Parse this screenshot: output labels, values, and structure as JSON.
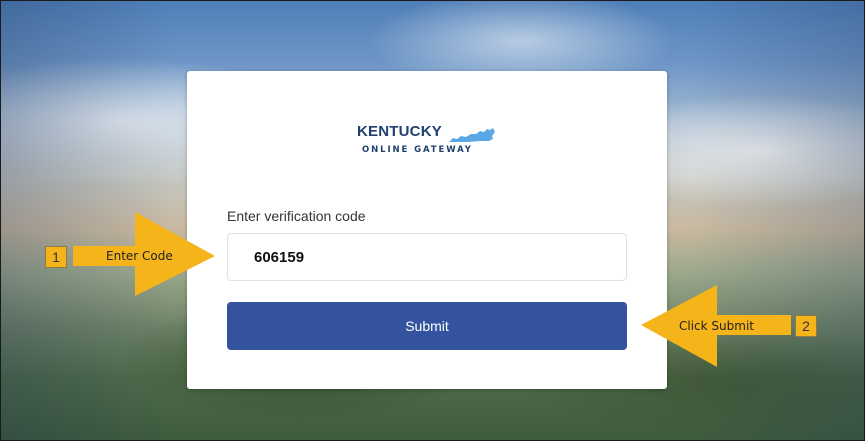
{
  "logo": {
    "word": "KENTUCKY",
    "subtitle": "ONLINE GATEWAY",
    "text_color": "#1f3f6e",
    "shape_color": "#5aa9e6"
  },
  "form": {
    "label": "Enter verification code",
    "code_value": "606159",
    "submit_label": "Submit",
    "button_color": "#33539e"
  },
  "callouts": {
    "step1": {
      "number": "1",
      "text": "Enter Code"
    },
    "step2": {
      "number": "2",
      "text": "Click Submit"
    },
    "color": "#f4b41a"
  }
}
